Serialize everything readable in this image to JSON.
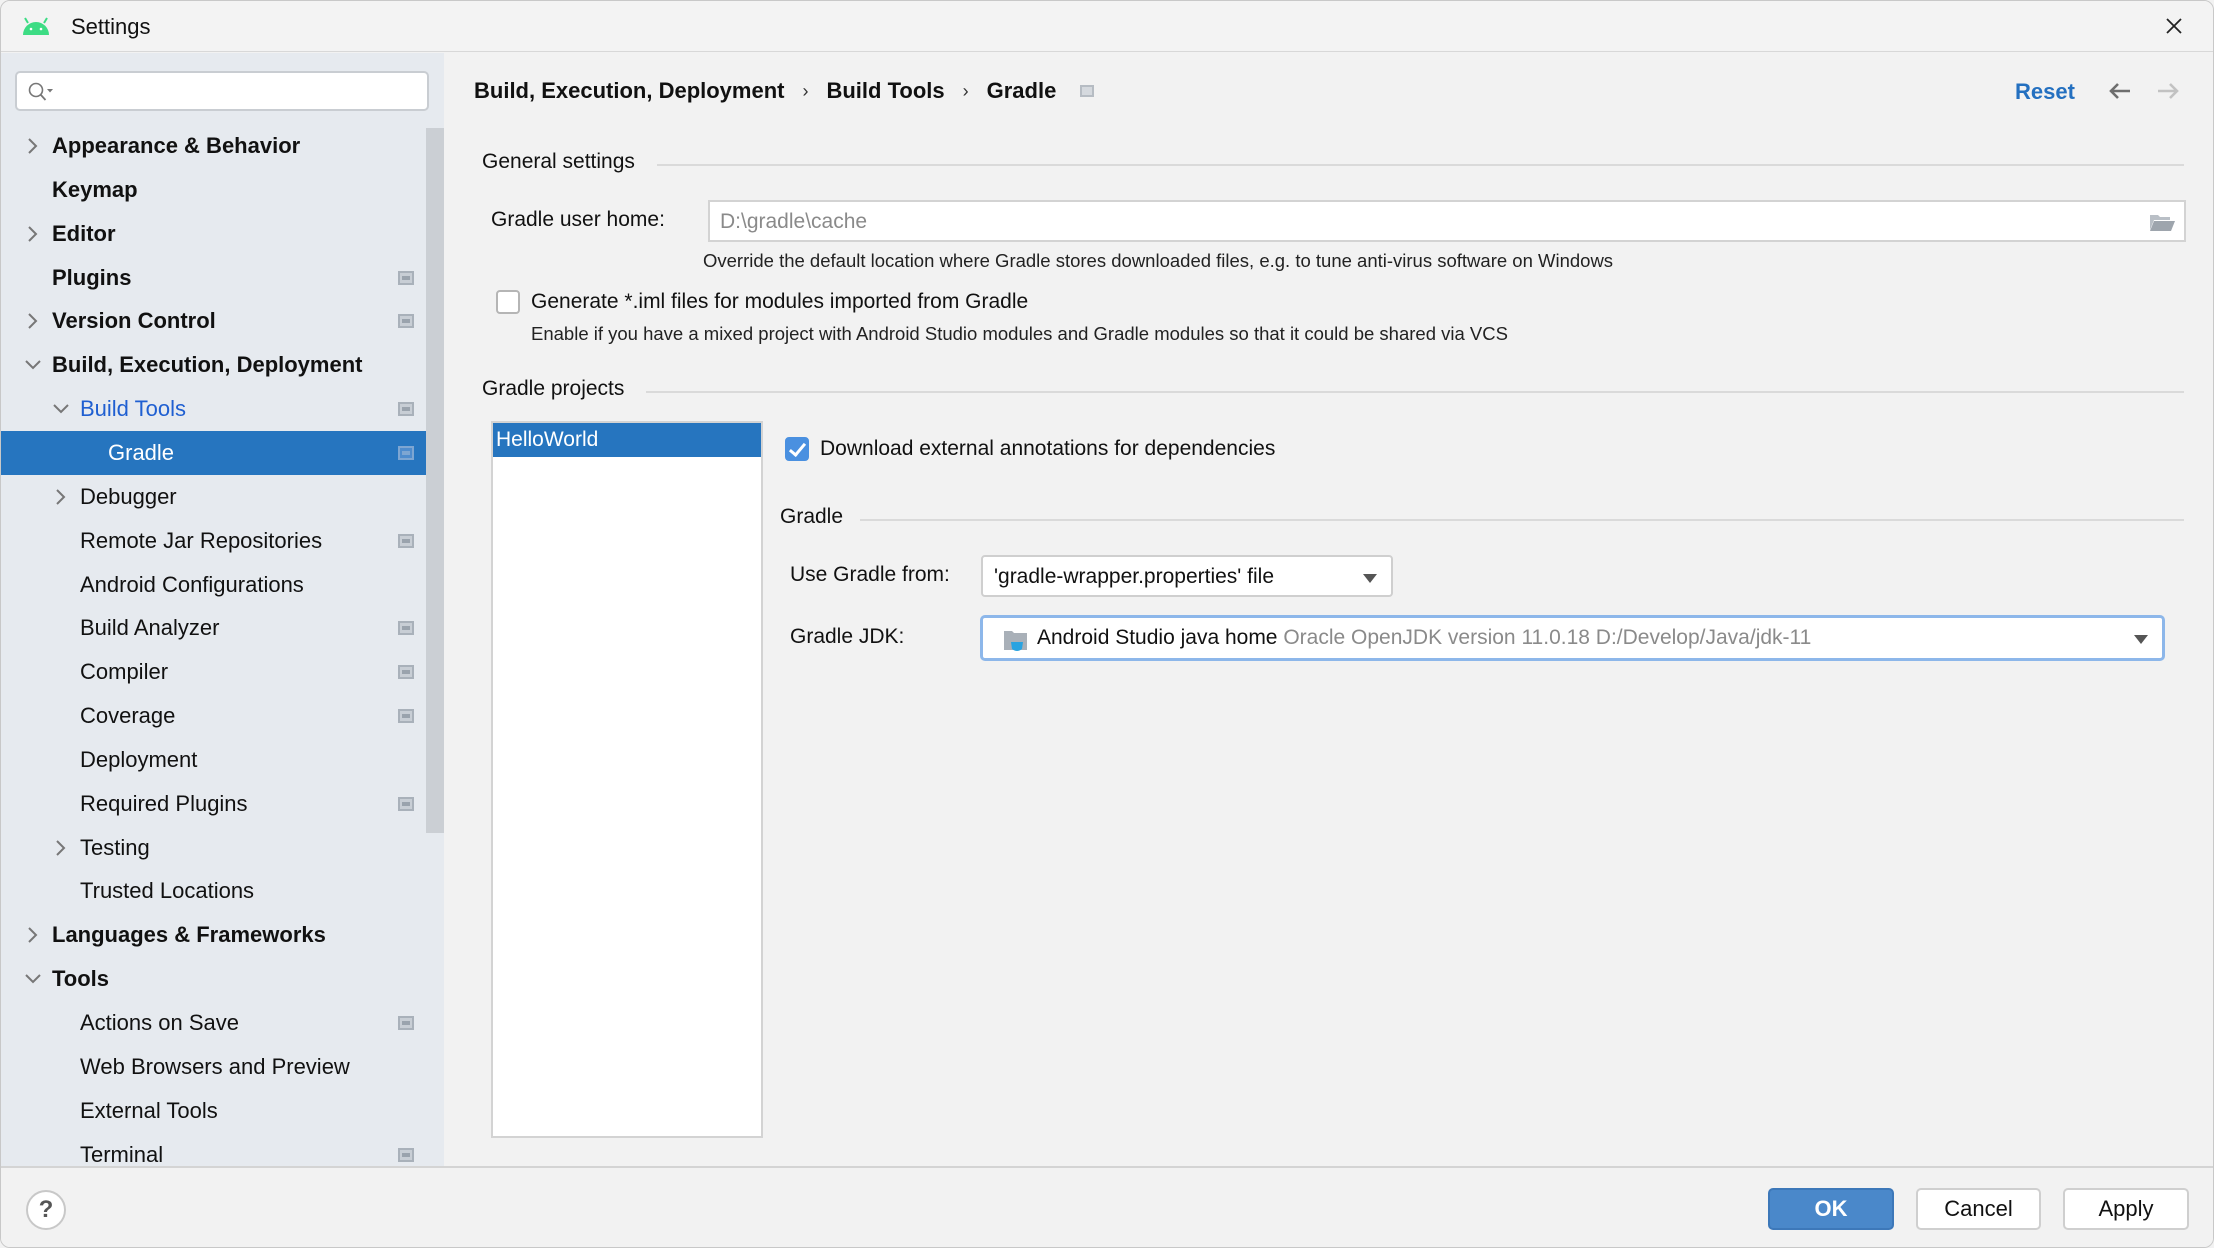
{
  "window": {
    "title": "Settings"
  },
  "search": {
    "value": "",
    "placeholder": ""
  },
  "sidebar": {
    "items": [
      {
        "label": "Appearance & Behavior",
        "level": 0,
        "expander": "collapsed",
        "project_icon": false
      },
      {
        "label": "Keymap",
        "level": 0,
        "expander": "none",
        "project_icon": false
      },
      {
        "label": "Editor",
        "level": 0,
        "expander": "collapsed",
        "project_icon": false
      },
      {
        "label": "Plugins",
        "level": 0,
        "expander": "none",
        "project_icon": true
      },
      {
        "label": "Version Control",
        "level": 0,
        "expander": "collapsed",
        "project_icon": true
      },
      {
        "label": "Build, Execution, Deployment",
        "level": 0,
        "expander": "expanded",
        "project_icon": false
      },
      {
        "label": "Build Tools",
        "level": 1,
        "expander": "expanded",
        "project_icon": true,
        "highlight": true
      },
      {
        "label": "Gradle",
        "level": 2,
        "expander": "none",
        "project_icon": true,
        "selected": true
      },
      {
        "label": "Debugger",
        "level": 1,
        "expander": "collapsed",
        "project_icon": false
      },
      {
        "label": "Remote Jar Repositories",
        "level": 1,
        "expander": "none",
        "project_icon": true
      },
      {
        "label": "Android Configurations",
        "level": 1,
        "expander": "none",
        "project_icon": false
      },
      {
        "label": "Build Analyzer",
        "level": 1,
        "expander": "none",
        "project_icon": true
      },
      {
        "label": "Compiler",
        "level": 1,
        "expander": "none",
        "project_icon": true
      },
      {
        "label": "Coverage",
        "level": 1,
        "expander": "none",
        "project_icon": true
      },
      {
        "label": "Deployment",
        "level": 1,
        "expander": "none",
        "project_icon": false
      },
      {
        "label": "Required Plugins",
        "level": 1,
        "expander": "none",
        "project_icon": true
      },
      {
        "label": "Testing",
        "level": 1,
        "expander": "collapsed",
        "project_icon": false
      },
      {
        "label": "Trusted Locations",
        "level": 1,
        "expander": "none",
        "project_icon": false
      },
      {
        "label": "Languages & Frameworks",
        "level": 0,
        "expander": "collapsed",
        "project_icon": false
      },
      {
        "label": "Tools",
        "level": 0,
        "expander": "expanded",
        "project_icon": false
      },
      {
        "label": "Actions on Save",
        "level": 1,
        "expander": "none",
        "project_icon": true
      },
      {
        "label": "Web Browsers and Preview",
        "level": 1,
        "expander": "none",
        "project_icon": false
      },
      {
        "label": "External Tools",
        "level": 1,
        "expander": "none",
        "project_icon": false
      },
      {
        "label": "Terminal",
        "level": 1,
        "expander": "none",
        "project_icon": true
      }
    ]
  },
  "header": {
    "breadcrumb": [
      "Build, Execution, Deployment",
      "Build Tools",
      "Gradle"
    ],
    "breadcrumb_separator": "›",
    "reset_label": "Reset"
  },
  "general": {
    "section_title": "General settings",
    "gradle_user_home_label": "Gradle user home:",
    "gradle_user_home_value": "D:\\gradle\\cache",
    "gradle_user_home_hint": "Override the default location where Gradle stores downloaded files, e.g. to tune anti-virus software on Windows",
    "generate_iml_label": "Generate *.iml files for modules imported from Gradle",
    "generate_iml_checked": false,
    "generate_iml_hint": "Enable if you have a mixed project with Android Studio modules and Gradle modules so that it could be shared via VCS"
  },
  "projects": {
    "section_title": "Gradle projects",
    "list": [
      "HelloWorld"
    ],
    "selected": "HelloWorld",
    "download_annotations_label": "Download external annotations for dependencies",
    "download_annotations_checked": true,
    "gradle_section_title": "Gradle",
    "use_gradle_from_label": "Use Gradle from:",
    "use_gradle_from_value": "'gradle-wrapper.properties' file",
    "gradle_jdk_label": "Gradle JDK:",
    "gradle_jdk_name": "Android Studio java home",
    "gradle_jdk_detail": "Oracle OpenJDK version 11.0.18 D:/Develop/Java/jdk-11"
  },
  "footer": {
    "help_label": "?",
    "ok_label": "OK",
    "cancel_label": "Cancel",
    "apply_label": "Apply"
  },
  "colors": {
    "accent": "#2675bf",
    "link": "#2470c0",
    "sidebar_bg": "#e6eaef",
    "android_green": "#3ddc84"
  }
}
